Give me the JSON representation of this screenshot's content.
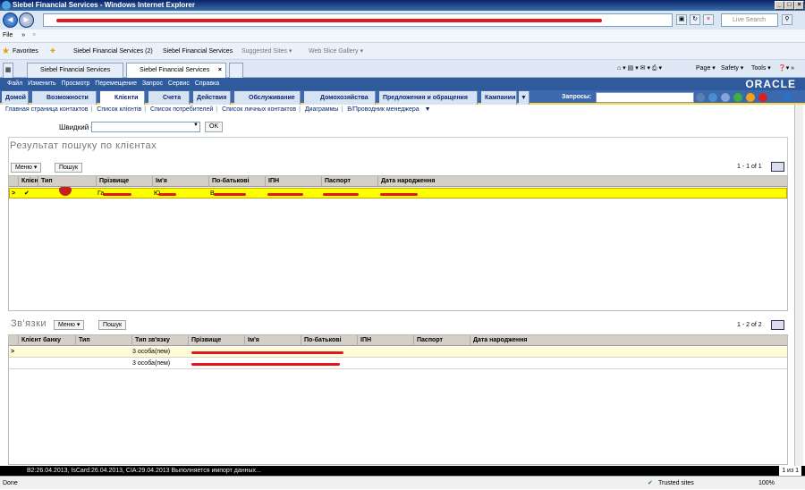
{
  "window": {
    "title": "Siebel Financial Services - Windows Internet Explorer"
  },
  "ie": {
    "search_placeholder": "Live Search",
    "menu": [
      "File",
      "»",
      "×"
    ],
    "favorites_label": "Favorites",
    "favorites": [
      "Siebel Financial Services (2)",
      "Siebel Financial Services",
      "Suggested Sites ▾",
      "Web Slice Gallery ▾"
    ],
    "tabs": [
      "Siebel Financial Services",
      "Siebel Financial Services"
    ],
    "commands": [
      "Page ▾",
      "Safety ▾",
      "Tools ▾"
    ]
  },
  "siebel": {
    "menu": [
      "Файл",
      "Изменить",
      "Просмотр",
      "Перемещение",
      "Запрос",
      "Сервис",
      "Справка"
    ],
    "brand": "ORACLE",
    "screen_tabs": [
      "Домой",
      "Возможности",
      "Клієнти",
      "Счета",
      "Действия",
      "Обслуживание",
      "Домохозяйства",
      "Предложения и обращения",
      "Кампании"
    ],
    "query_label": "Запросы:",
    "links": [
      "Главная страница контактов",
      "Список клієнтів",
      "Список потребителей",
      "Список личных контактов",
      "Диаграммы",
      "В/Проводник менеджера"
    ],
    "quick_label": "Швидкий СЗ:",
    "ok": "OK"
  },
  "results": {
    "title": "Результат пошуку по клієнтах",
    "menu": "Меню ▾",
    "query_btn": "Пошук",
    "counter": "1 - 1 of 1",
    "columns": [
      "Клієн",
      "Тип",
      "Прізвище",
      "Ім'я",
      "По-батькові",
      "ІПН",
      "Паспорт",
      "Дата народження"
    ],
    "row": {
      "surname": "Га",
      "name": "Ю",
      "patronymic": "В"
    }
  },
  "relations": {
    "title": "Зв'язки",
    "menu": "Меню ▾",
    "query_btn": "Пошук",
    "counter": "1 - 2 of 2",
    "columns": [
      "Клієнт банку",
      "Тип",
      "Тип зв'язку",
      "Прізвище",
      "Ім'я",
      "По-батькові",
      "ІПН",
      "Паспорт",
      "Дата народження"
    ],
    "rows": [
      {
        "relation_type": "3 особа(пем)"
      },
      {
        "relation_type": "3 особа(пем)"
      }
    ]
  },
  "status": {
    "message": "В2:26.04.2013, IsCard:26.04.2013, CIA:29.04.2013 Выполняется импорт данных...",
    "page": "1 из 1",
    "done": "Done",
    "zone": "Trusted sites",
    "zoom": "100%"
  }
}
